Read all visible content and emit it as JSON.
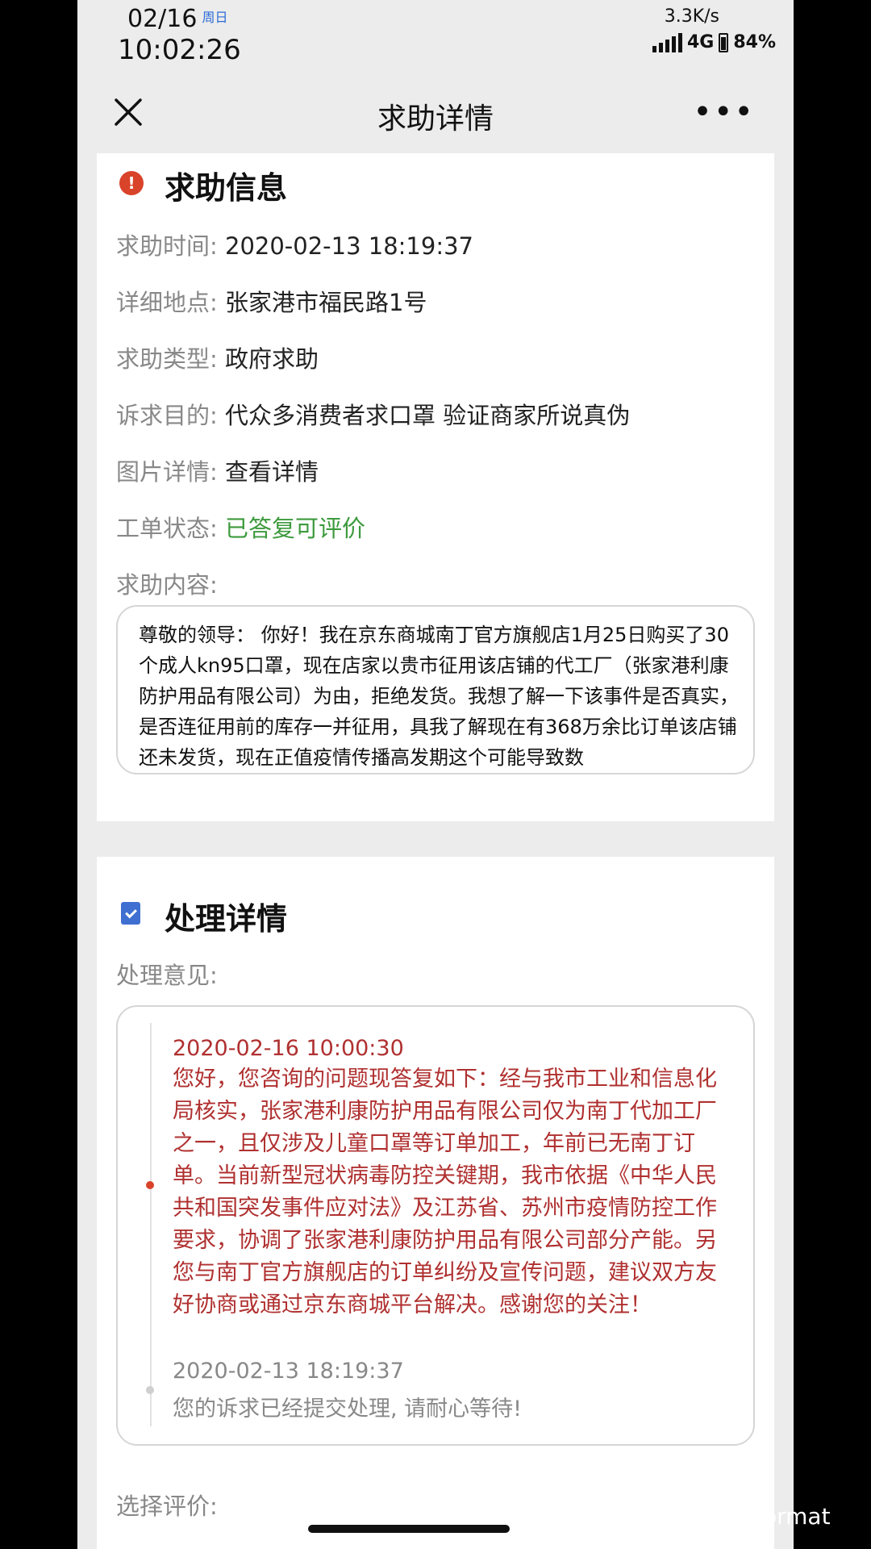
{
  "status_bar": {
    "date": "02/16",
    "weekday": "周日",
    "time": "10:02:26",
    "speed": "3.3K/s",
    "network": "4G",
    "battery": "84%"
  },
  "nav": {
    "title": "求助详情"
  },
  "help_info": {
    "title": "求助信息",
    "fields": [
      {
        "label": "求助时间:",
        "value": "2020-02-13 18:19:37"
      },
      {
        "label": "详细地点:",
        "value": "张家港市福民路1号"
      },
      {
        "label": "求助类型:",
        "value": "政府求助"
      },
      {
        "label": "诉求目的:",
        "value": "代众多消费者求口罩 验证商家所说真伪"
      },
      {
        "label": "图片详情:",
        "value": "查看详情"
      },
      {
        "label": "工单状态:",
        "value": "已答复可评价"
      }
    ],
    "content_label": "求助内容:",
    "content_text": "尊敬的领导： 你好！我在京东商城南丁官方旗舰店1月25日购买了30个成人kn95口罩，现在店家以贵市征用该店铺的代工厂（张家港利康防护用品有限公司）为由，拒绝发货。我想了解一下该事件是否真实，是否连征用前的库存一并征用，具我了解现在有368万余比订单该店铺还未发货，现在正值疫情传播高发期这个可能导致数"
  },
  "process": {
    "title": "处理详情",
    "opinion_label": "处理意见:",
    "reply_date": "2020-02-16 10:00:30",
    "reply_text": "您好，您咨询的问题现答复如下：经与我市工业和信息化局核实，张家港利康防护用品有限公司仅为南丁代加工厂之一，且仅涉及儿童口罩等订单加工，年前已无南丁订单。当前新型冠状病毒防控关键期，我市依据《中华人民共和国突发事件应对法》及江苏省、苏州市疫情防控工作要求，协调了张家港利康防护用品有限公司部分产能。另您与南丁官方旗舰店的订单纠纷及宣传问题，建议双方友好协商或通过京东商城平台解决。感谢您的关注！",
    "submit_date": "2020-02-13 18:19:37",
    "submit_text": "您的诉求已经提交处理, 请耐心等待!",
    "eval_label": "选择评价:"
  },
  "watermark": "知乎 @Format",
  "colors": {
    "accent_red": "#d9432a",
    "reply_red": "#b03030",
    "status_green": "#3d9a3d",
    "doc_blue": "#3f6fd1"
  },
  "icons": [
    "close-icon",
    "more-icon",
    "info-icon",
    "document-icon",
    "signal-icon",
    "battery-icon"
  ]
}
